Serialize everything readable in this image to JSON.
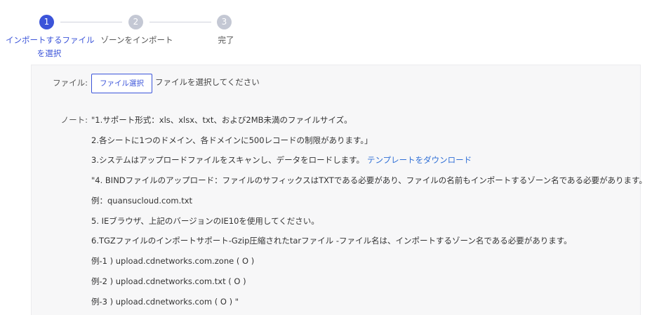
{
  "steps": [
    {
      "number": "1",
      "label_line1": "インポートするファイル",
      "label_line2": "を選択",
      "state": "active"
    },
    {
      "number": "2",
      "label_line1": "ゾーンをインポート",
      "label_line2": "",
      "state": "inactive"
    },
    {
      "number": "3",
      "label_line1": "完了",
      "label_line2": "",
      "state": "inactive"
    }
  ],
  "file_row": {
    "label": "ファイル:",
    "button_label": "ファイル選択",
    "hint": "ファイルを選択してください"
  },
  "note_row": {
    "label": "ノート:",
    "lines": [
      "\"1.サポート形式：xls、xlsx、txt、および2MB未満のファイルサイズ。",
      "2.各シートに1つのドメイン、各ドメインに500レコードの制限があります。」",
      "3.システムはアップロードファイルをスキャンし、データをロードします。",
      "\"4. BINDファイルのアップロード：ファイルのサフィックスはTXTである必要があり、ファイルの名前もインポートするゾーン名である必要があります。",
      "例：quansucloud.com.txt",
      "5. IEブラウザ、上記のバージョンのIE10を使用してください。",
      "6.TGZファイルのインポートサポート-Gzip圧縮されたtarファイル -ファイル名は、インポートするゾーン名である必要があります。",
      "例-1 ) upload.cdnetworks.com.zone ( O )",
      "例-2 ) upload.cdnetworks.com.txt ( O )",
      "例-3 ) upload.cdnetworks.com ( O ) \""
    ],
    "template_link": "テンプレートをダウンロード"
  },
  "colors": {
    "accent": "#3b54d9",
    "inactive_step": "#c4c8d4",
    "link": "#2f6fd6",
    "panel_bg": "#f7f7f8"
  }
}
